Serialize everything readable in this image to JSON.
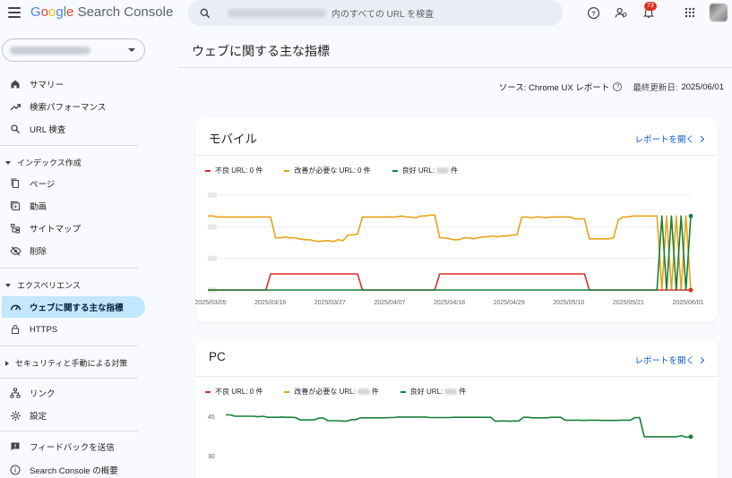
{
  "app": {
    "brand_letters": [
      "G",
      "o",
      "o",
      "g",
      "l",
      "e"
    ],
    "product": "Search Console",
    "search_placeholder": "内のすべての URL を検査",
    "notification_count": "73"
  },
  "sidebar": {
    "items": [
      {
        "label": "サマリー",
        "icon": "home-icon"
      },
      {
        "label": "検索パフォーマンス",
        "icon": "trending-up-icon"
      },
      {
        "label": "URL 検査",
        "icon": "search-icon"
      }
    ],
    "sections": [
      {
        "label": "インデックス作成",
        "items": [
          {
            "label": "ページ",
            "icon": "pages-icon"
          },
          {
            "label": "動画",
            "icon": "video-icon"
          },
          {
            "label": "サイトマップ",
            "icon": "sitemap-icon"
          },
          {
            "label": "削除",
            "icon": "removal-icon"
          }
        ]
      },
      {
        "label": "エクスペリエンス",
        "items": [
          {
            "label": "ウェブに関する主な指標",
            "icon": "gauge-icon",
            "active": true
          },
          {
            "label": "HTTPS",
            "icon": "lock-icon"
          }
        ]
      },
      {
        "label": "セキュリティと手動による対策",
        "items": []
      }
    ],
    "bottom_items": [
      {
        "label": "リンク",
        "icon": "links-icon"
      },
      {
        "label": "設定",
        "icon": "settings-icon"
      },
      {
        "label": "フィードバックを送信",
        "icon": "feedback-icon"
      },
      {
        "label": "Search Console の概要",
        "icon": "info-icon"
      }
    ]
  },
  "main": {
    "title": "ウェブに関する主な指標",
    "source_label": "ソース: Chrome UX レポート",
    "updated_label": "最終更新日:",
    "updated_date": "2025/06/01"
  },
  "cards": {
    "mobile": {
      "title": "モバイル",
      "link": "レポートを開く",
      "legend_poor": "不良 URL: 0 件",
      "legend_ni": "改善が必要な URL: 0 件",
      "legend_good_prefix": "良好 URL:",
      "legend_good_suffix": "件"
    },
    "pc": {
      "title": "PC",
      "link": "レポートを開く",
      "legend_poor": "不良 URL: 0 件",
      "legend_ni_prefix": "改善が必要な URL:",
      "legend_ni_suffix": "件",
      "legend_good_prefix": "良好 URL:",
      "legend_good_suffix": "件"
    }
  },
  "colors": {
    "poor": "#d93025",
    "needs_improvement": "#e8a317",
    "good": "#188038",
    "link": "#0b57d0",
    "active_nav": "#c2e7ff"
  },
  "chart_data": [
    {
      "type": "line",
      "title": "モバイル",
      "x_ticks": [
        "2025/03/05",
        "2025/03/16",
        "2025/03/27",
        "2025/04/07",
        "2025/04/18",
        "2025/04/29",
        "2025/05/10",
        "2025/05/21",
        "2025/06/01"
      ],
      "series": [
        {
          "name": "改善が必要",
          "values": [
            0.78,
            0.78,
            0.77,
            0.77,
            0.77,
            0.77,
            0.77,
            0.77,
            0.77,
            0.77,
            0.77,
            0.77,
            0.77,
            0.77,
            0.55,
            0.55,
            0.56,
            0.55,
            0.55,
            0.54,
            0.53,
            0.53,
            0.52,
            0.51,
            0.52,
            0.52,
            0.51,
            0.53,
            0.52,
            0.58,
            0.58,
            0.59,
            0.77,
            0.77,
            0.77,
            0.77,
            0.77,
            0.77,
            0.77,
            0.77,
            0.78,
            0.77,
            0.77,
            0.76,
            0.78,
            0.78,
            0.79,
            0.79,
            0.55,
            0.55,
            0.54,
            0.53,
            0.53,
            0.55,
            0.55,
            0.54,
            0.55,
            0.56,
            0.56,
            0.57,
            0.56,
            0.57,
            0.57,
            0.58,
            0.58,
            0.77,
            0.77,
            0.76,
            0.77,
            0.77,
            0.76,
            0.77,
            0.77,
            0.77,
            0.77,
            0.77,
            0.75,
            0.75,
            0.75,
            0.54,
            0.54,
            0.54,
            0.54,
            0.54,
            0.55,
            0.74,
            0.77,
            0.77,
            0.78,
            0.78,
            0.78,
            0.78,
            0.78,
            0.78,
            0.0,
            0.78,
            0.0,
            0.78,
            0.0,
            0.78,
            0.0
          ]
        },
        {
          "name": "不良",
          "values": [
            0,
            0,
            0,
            0,
            0,
            0,
            0,
            0,
            0,
            0,
            0,
            0,
            0,
            0.17,
            0.17,
            0.17,
            0.17,
            0.17,
            0.17,
            0.17,
            0.17,
            0.17,
            0.17,
            0.17,
            0.17,
            0.17,
            0.17,
            0.17,
            0.17,
            0.17,
            0.17,
            0.17,
            0,
            0,
            0,
            0,
            0,
            0,
            0,
            0,
            0,
            0,
            0,
            0,
            0,
            0,
            0,
            0,
            0.17,
            0.17,
            0.17,
            0.17,
            0.17,
            0.17,
            0.17,
            0.17,
            0.17,
            0.17,
            0.17,
            0.17,
            0.17,
            0.17,
            0.17,
            0.17,
            0.17,
            0.17,
            0.17,
            0.17,
            0.17,
            0.17,
            0.17,
            0.17,
            0.17,
            0.17,
            0.17,
            0.17,
            0.17,
            0.17,
            0.17,
            0,
            0,
            0,
            0,
            0,
            0,
            0,
            0,
            0,
            0,
            0,
            0,
            0,
            0,
            0,
            0,
            0,
            0,
            0,
            0,
            0,
            0
          ]
        },
        {
          "name": "良好",
          "values": [
            0,
            0,
            0,
            0,
            0,
            0,
            0,
            0,
            0,
            0,
            0,
            0,
            0,
            0,
            0,
            0,
            0,
            0,
            0,
            0,
            0,
            0,
            0,
            0,
            0,
            0,
            0,
            0,
            0,
            0,
            0,
            0,
            0,
            0,
            0,
            0,
            0,
            0,
            0,
            0,
            0,
            0,
            0,
            0,
            0,
            0,
            0,
            0,
            0,
            0,
            0,
            0,
            0,
            0,
            0,
            0,
            0,
            0,
            0,
            0,
            0,
            0,
            0,
            0,
            0,
            0,
            0,
            0,
            0,
            0,
            0,
            0,
            0,
            0,
            0,
            0,
            0,
            0,
            0,
            0,
            0,
            0,
            0,
            0,
            0,
            0,
            0,
            0,
            0,
            0,
            0,
            0,
            0,
            0,
            0.78,
            0,
            0.78,
            0,
            0.78,
            0,
            0.78
          ]
        }
      ]
    },
    {
      "type": "line",
      "title": "PC",
      "y_ticks": [
        "45",
        "30"
      ],
      "series": [
        {
          "name": "良好",
          "values": [
            45.5,
            45.5,
            45,
            45,
            45,
            45,
            45,
            44.8,
            45,
            44.6,
            44.6,
            44.6,
            44.7,
            44.6,
            44.6,
            44.5,
            43.6,
            43.6,
            43.6,
            43.6,
            44.3,
            44.3,
            43.3,
            43.3,
            43.3,
            43.2,
            43.1,
            43.7,
            43.7,
            44.4,
            44.4,
            44.4,
            44.4,
            44.4,
            44.4,
            44.5,
            44.5,
            44.7,
            44.7,
            44.7,
            44.7,
            44.7,
            44.7,
            44.7,
            44.5,
            44.5,
            44.5,
            44.5,
            44.5,
            44.6,
            44.6,
            44.6,
            44.6,
            44.6,
            44.6,
            44.6,
            44.6,
            44.6,
            43.1,
            43.2,
            43.2,
            43.1,
            43.2,
            43.2,
            44.6,
            44.6,
            44.4,
            44.4,
            44.4,
            44.4,
            44.6,
            44.6,
            44.6,
            43.5,
            43.5,
            43.5,
            43.5,
            43.4,
            43.5,
            43.5,
            43.5,
            43.4,
            43.4,
            43.4,
            43.4,
            43.5,
            43.5,
            43.5,
            44.5,
            44.5,
            37.2,
            37.2,
            37.2,
            37.2,
            37.2,
            37.2,
            37.2,
            37.2,
            37.6,
            37.0,
            37.2
          ]
        }
      ]
    }
  ]
}
